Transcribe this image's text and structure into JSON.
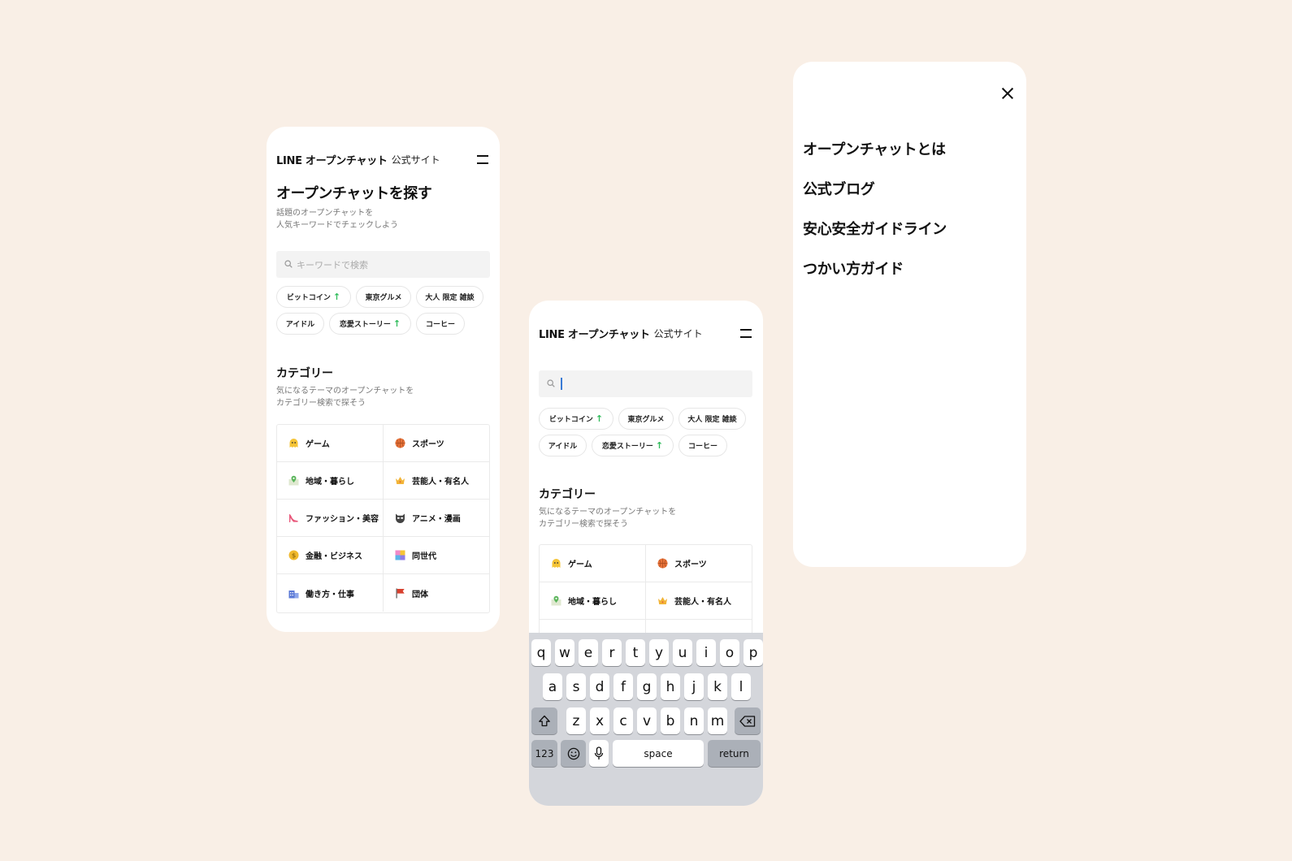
{
  "brand": {
    "logo": "LINE オープンチャット",
    "subtitle": "公式サイト"
  },
  "home": {
    "title": "オープンチャットを探す",
    "subtitle_line1": "話題のオープンチャットを",
    "subtitle_line2": "人気キーワードでチェックしよう"
  },
  "search": {
    "placeholder": "キーワードで検索",
    "value": ""
  },
  "keywords": [
    {
      "label": "ビットコイン",
      "trending": true
    },
    {
      "label": "東京グルメ",
      "trending": false
    },
    {
      "label": "大人 限定 雑談",
      "trending": false
    },
    {
      "label": "アイドル",
      "trending": false
    },
    {
      "label": "恋愛ストーリー",
      "trending": true
    },
    {
      "label": "コーヒー",
      "trending": false
    }
  ],
  "trend_arrow": "↑",
  "categories_section": {
    "title": "カテゴリー",
    "subtitle_line1": "気になるテーマのオープンチャットを",
    "subtitle_line2": "カテゴリー検索で探そう"
  },
  "categories": [
    {
      "label": "ゲーム",
      "icon": "ghost-icon",
      "color": "#f5c436"
    },
    {
      "label": "スポーツ",
      "icon": "basketball-icon",
      "color": "#e8733a"
    },
    {
      "label": "地域・暮らし",
      "icon": "map-pin-icon",
      "color": "#5bb55b"
    },
    {
      "label": "芸能人・有名人",
      "icon": "crown-icon",
      "color": "#f2b437"
    },
    {
      "label": "ファッション・美容",
      "icon": "high-heel-icon",
      "color": "#e8577a"
    },
    {
      "label": "アニメ・漫画",
      "icon": "mask-icon",
      "color": "#444444"
    },
    {
      "label": "金融・ビジネス",
      "icon": "coin-icon",
      "color": "#f0b92e"
    },
    {
      "label": "同世代",
      "icon": "blocks-icon",
      "color": "#8e7be8"
    },
    {
      "label": "働き方・仕事",
      "icon": "building-icon",
      "color": "#5b79d6"
    },
    {
      "label": "団体",
      "icon": "flag-icon",
      "color": "#d8402e"
    }
  ],
  "keyboard": {
    "row1": [
      "q",
      "w",
      "e",
      "r",
      "t",
      "y",
      "u",
      "i",
      "o",
      "p"
    ],
    "row2": [
      "a",
      "s",
      "d",
      "f",
      "g",
      "h",
      "j",
      "k",
      "l"
    ],
    "row3": [
      "z",
      "x",
      "c",
      "v",
      "b",
      "n",
      "m"
    ],
    "numbers_label": "123",
    "space_label": "space",
    "return_label": "return"
  },
  "menu": {
    "items": [
      "オープンチャットとは",
      "公式ブログ",
      "安心安全ガイドライン",
      "つかい方ガイド"
    ]
  }
}
